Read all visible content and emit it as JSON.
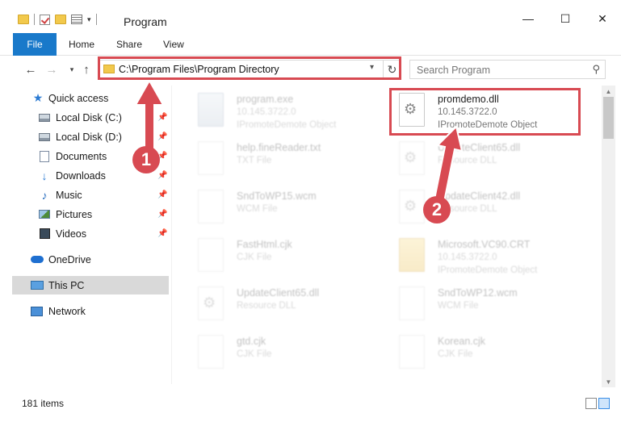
{
  "window": {
    "title": "Program",
    "minimize": "—",
    "maximize": "☐",
    "close": "✕"
  },
  "ribbon": {
    "tabs": [
      "File",
      "Home",
      "Share",
      "View"
    ]
  },
  "address_bar": {
    "path": "C:\\Program Files\\Program Directory",
    "search_placeholder": "Search Program"
  },
  "sidebar": {
    "items": [
      {
        "label": "Quick access",
        "icon": "star-icon"
      },
      {
        "label": "Local Disk (C:)",
        "icon": "drive-icon",
        "pinned": true
      },
      {
        "label": "Local Disk (D:)",
        "icon": "drive-icon",
        "pinned": true
      },
      {
        "label": "Documents",
        "icon": "documents-icon",
        "pinned": true
      },
      {
        "label": "Downloads",
        "icon": "download-icon",
        "pinned": true
      },
      {
        "label": "Music",
        "icon": "music-icon",
        "pinned": true
      },
      {
        "label": "Pictures",
        "icon": "pictures-icon",
        "pinned": true
      },
      {
        "label": "Videos",
        "icon": "video-icon",
        "pinned": true
      },
      {
        "label": "OneDrive",
        "icon": "cloud-icon"
      },
      {
        "label": "This PC",
        "icon": "computer-icon",
        "selected": true
      },
      {
        "label": "Network",
        "icon": "network-icon"
      }
    ]
  },
  "files": [
    {
      "name": "program.exe",
      "sub1": "10.145.3722.0",
      "sub2": "IPromoteDemote Object",
      "icon": "exe-icon",
      "highlighted": false
    },
    {
      "name": "promdemo.dll",
      "sub1": "10.145.3722.0",
      "sub2": "IPromoteDemote Object",
      "icon": "dll-icon",
      "highlighted": true
    },
    {
      "name": "help.fineReader.txt",
      "sub1": "TXT File",
      "sub2": "",
      "icon": "text-file-icon",
      "highlighted": false
    },
    {
      "name": "UpdateClient65.dll",
      "sub1": "Resource DLL",
      "sub2": "",
      "icon": "dll-icon",
      "highlighted": false
    },
    {
      "name": "SndToWP15.wcm",
      "sub1": "WCM File",
      "sub2": "",
      "icon": "file-icon",
      "highlighted": false
    },
    {
      "name": "UpdateClient42.dll",
      "sub1": "Resource DLL",
      "sub2": "",
      "icon": "dll-icon",
      "highlighted": false
    },
    {
      "name": "FastHtml.cjk",
      "sub1": "CJK File",
      "sub2": "",
      "icon": "file-icon",
      "highlighted": false
    },
    {
      "name": "Microsoft.VC90.CRT",
      "sub1": "10.145.3722.0",
      "sub2": "IPromoteDemote Object",
      "icon": "folder-icon",
      "highlighted": false
    },
    {
      "name": "UpdateClient65.dll",
      "sub1": "Resource DLL",
      "sub2": "",
      "icon": "dll-icon",
      "highlighted": false
    },
    {
      "name": "SndToWP12.wcm",
      "sub1": "WCM File",
      "sub2": "",
      "icon": "file-icon",
      "highlighted": false
    },
    {
      "name": "gtd.cjk",
      "sub1": "CJK File",
      "sub2": "",
      "icon": "file-icon",
      "highlighted": false
    },
    {
      "name": "Korean.cjk",
      "sub1": "CJK File",
      "sub2": "",
      "icon": "file-icon",
      "highlighted": false
    }
  ],
  "status_bar": {
    "item_count": "181 items"
  },
  "callouts": [
    {
      "number": "1"
    },
    {
      "number": "2"
    }
  ],
  "colors": {
    "accent": "#1979ca",
    "highlight": "#d84a52",
    "selected_bg": "#d9d9d9"
  }
}
